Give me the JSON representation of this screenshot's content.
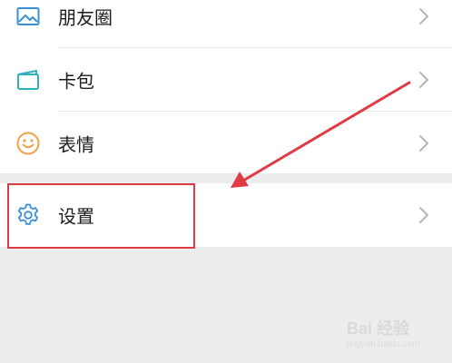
{
  "menu": {
    "items": [
      {
        "label": "朋友圈",
        "icon": "photo-album-icon"
      },
      {
        "label": "卡包",
        "icon": "card-wallet-icon"
      },
      {
        "label": "表情",
        "icon": "emoji-smile-icon"
      }
    ],
    "settings": {
      "label": "设置",
      "icon": "gear-icon"
    }
  },
  "annotation": {
    "color": "#e03a44",
    "target": "设置"
  },
  "watermark": {
    "main": "Bai 经验",
    "sub": "jingyan.baidu.com"
  },
  "colors": {
    "icon_blue": "#3a8fd6",
    "icon_teal": "#2fb1bf",
    "icon_orange": "#f2a24a",
    "background": "#ededed"
  }
}
